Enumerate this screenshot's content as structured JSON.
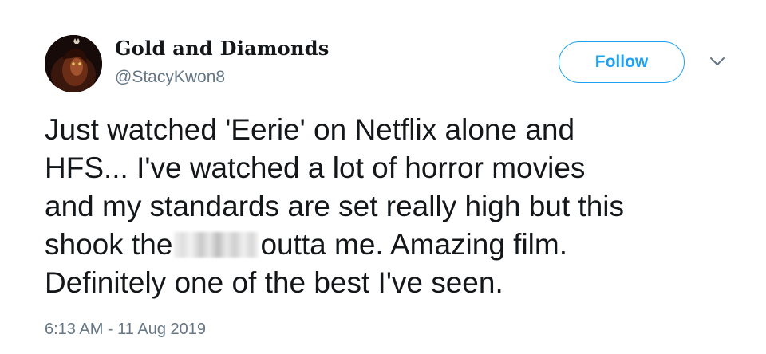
{
  "user": {
    "display_name": "Gold and Diamonds",
    "handle": "@StacyKwon8",
    "avatar_icon": "dark-lion-portrait-avatar"
  },
  "actions": {
    "follow_label": "Follow",
    "menu_icon": "chevron-down-icon"
  },
  "tweet": {
    "lines": [
      "Just watched 'Eerie' on Netflix alone and",
      "HFS... I've watched a lot of horror movies",
      "and my standards are set really high but this",
      "shook the",
      "outta me. Amazing film.",
      "Definitely one of the best I've seen."
    ],
    "timestamp": "6:13 AM - 11 Aug 2019"
  },
  "colors": {
    "accent": "#1da1f2",
    "text": "#14171a",
    "secondary": "#657786"
  }
}
